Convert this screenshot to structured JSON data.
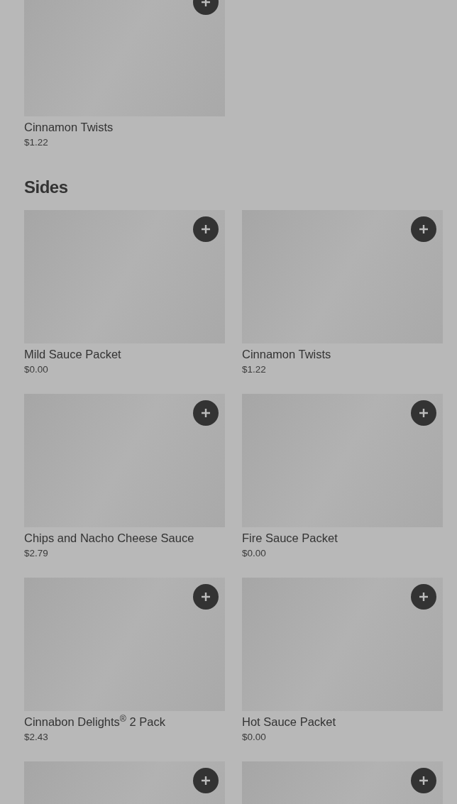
{
  "previous_section": {
    "items": [
      {
        "kind": "full",
        "name": "Cinnamon Twists",
        "price": "$1.22"
      }
    ]
  },
  "sides": {
    "title": "Sides",
    "items": [
      {
        "kind": "full",
        "name": "Mild Sauce Packet",
        "price": "$0.00"
      },
      {
        "kind": "full",
        "name": "Cinnamon Twists",
        "price": "$1.22"
      },
      {
        "kind": "full",
        "name": "Chips and Nacho Cheese Sauce",
        "price": "$2.79"
      },
      {
        "kind": "full",
        "name": "Fire Sauce Packet",
        "price": "$0.00"
      },
      {
        "kind": "full",
        "name": "Cinnabon Delights$^{®}$ 2 Pack",
        "price": "$2.43"
      },
      {
        "kind": "full",
        "name": "Hot Sauce Packet",
        "price": "$0.00"
      },
      {
        "kind": "cut_off"
      },
      {
        "kind": "cut_off"
      }
    ]
  }
}
